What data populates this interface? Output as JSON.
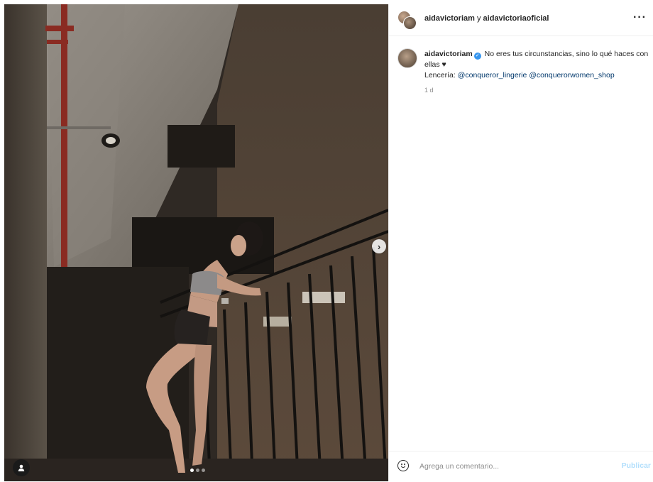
{
  "post": {
    "header": {
      "user1": "aidavictoriam",
      "joiner": " y ",
      "user2": "aidavictoriaoficial",
      "more_label": "···"
    },
    "caption": {
      "username": "aidavictoriam",
      "verified_mark": "✓",
      "text": " No eres tus circunstancias, sino lo qué haces con ellas ",
      "heart": "♥",
      "lingerie_label": "Lencería: ",
      "mention1": "@conqueror_lingerie",
      "mention2": "@conquerorwomen_shop"
    },
    "time_ago": "1 d",
    "media": {
      "next_label": "›",
      "carousel_total": 3,
      "carousel_active": 1
    },
    "comment": {
      "placeholder": "Agrega un comentario...",
      "publish_label": "Publicar"
    }
  },
  "colors": {
    "verified": "#3897f0",
    "mention": "#00376b",
    "publish_disabled": "#b2dffc",
    "muted": "#8e8e8e"
  },
  "icons": [
    "chevron-right-icon",
    "more-icon",
    "emoji-icon",
    "user-tag-icon",
    "verified-icon",
    "heart-icon"
  ]
}
